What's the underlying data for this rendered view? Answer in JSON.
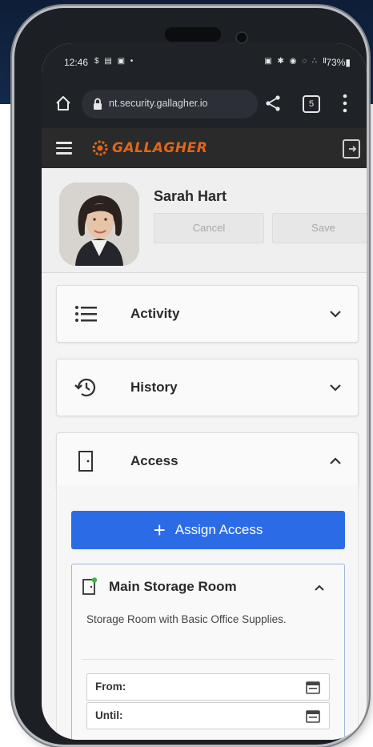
{
  "status_bar": {
    "time": "12:46",
    "left_icons": "$ ▤ ▣ •",
    "right_icons": "▣ ✱ ◉ ◌ ∴ Ⅱ",
    "battery": "73%▮"
  },
  "browser": {
    "url": "nt.security.gallagher.io",
    "tab_count": "5"
  },
  "app": {
    "brand_name": "GALLAGHER",
    "brand_color": "#e0661c"
  },
  "profile": {
    "name": "Sarah Hart",
    "cancel_label": "Cancel",
    "save_label": "Save"
  },
  "panels": [
    {
      "label": "Activity",
      "icon": "list-icon",
      "state": "collapsed"
    },
    {
      "label": "History",
      "icon": "history-icon",
      "state": "collapsed"
    },
    {
      "label": "Access",
      "icon": "door-icon",
      "state": "expanded"
    }
  ],
  "access": {
    "assign_label": "Assign Access",
    "assign_color": "#2c6be6",
    "door": {
      "title": "Main Storage Room",
      "description": "Storage Room with Basic Office Supplies.",
      "from_label": "From:",
      "until_label": "Until:"
    }
  }
}
